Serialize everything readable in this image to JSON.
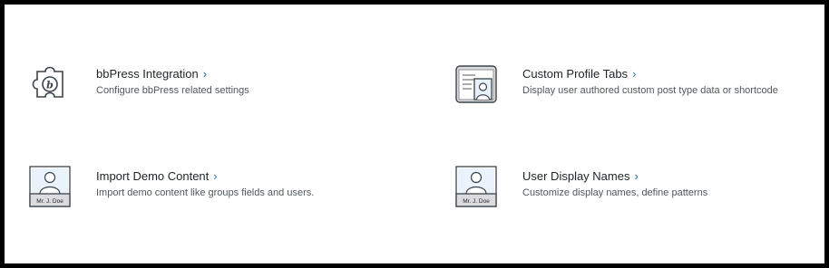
{
  "cards": [
    {
      "title": "bbPress Integration",
      "chevron": "›",
      "description": "Configure bbPress related settings",
      "icon": "puzzle-piece-icon"
    },
    {
      "title": "Custom Profile Tabs",
      "chevron": "›",
      "description": "Display user authored custom post type data or shortcode",
      "icon": "profile-tabs-icon"
    },
    {
      "title": "Import Demo Content",
      "chevron": "›",
      "description": "Import demo content like groups fields and users.",
      "icon": "user-card-icon",
      "badge": "Mr. J. Doe"
    },
    {
      "title": "User Display Names",
      "chevron": "›",
      "description": "Customize display names, define patterns",
      "icon": "user-card-icon",
      "badge": "Mr. J. Doe"
    }
  ],
  "colors": {
    "accent": "#2271b1",
    "title": "#1d2327",
    "description": "#50575e",
    "frame": "#000000"
  }
}
